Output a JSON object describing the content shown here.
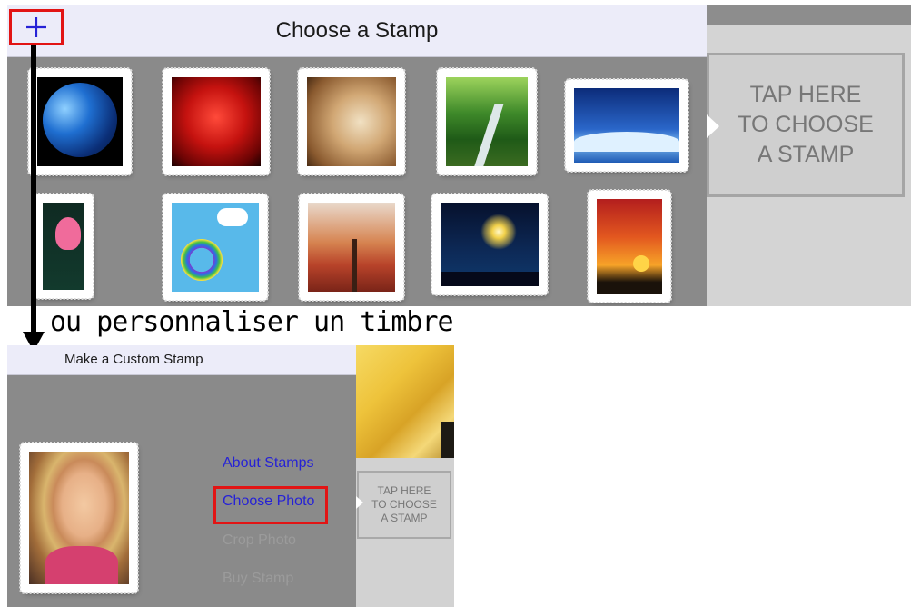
{
  "choose_panel": {
    "title": "Choose a Stamp",
    "add_icon": "plus-icon",
    "accent_color": "#2622d6",
    "highlight_color": "#e21414",
    "stamps": [
      {
        "name": "earth",
        "icon": "earth-stamp"
      },
      {
        "name": "rose",
        "icon": "rose-stamp"
      },
      {
        "name": "shell",
        "icon": "shell-stamp"
      },
      {
        "name": "forest",
        "icon": "forest-stamp"
      },
      {
        "name": "night sky",
        "icon": "night-sky-stamp"
      },
      {
        "name": "tulips",
        "icon": "tulips-stamp"
      },
      {
        "name": "rainbows",
        "icon": "rainbows-stamp"
      },
      {
        "name": "autumn tree",
        "icon": "autumn-tree-stamp"
      },
      {
        "name": "fireworks",
        "icon": "fireworks-stamp"
      },
      {
        "name": "sunset",
        "icon": "sunset-stamp"
      }
    ]
  },
  "tap_box": {
    "label": "TAP HERE\nTO CHOOSE\nA STAMP"
  },
  "caption": "ou personnaliser un timbre",
  "custom_panel": {
    "title": "Make a Custom Stamp",
    "menu": {
      "about": "About Stamps",
      "choose_photo": "Choose Photo",
      "crop_photo": "Crop Photo",
      "buy_stamp": "Buy Stamp"
    },
    "tap_box_label": "TAP HERE\nTO CHOOSE\nA STAMP"
  }
}
